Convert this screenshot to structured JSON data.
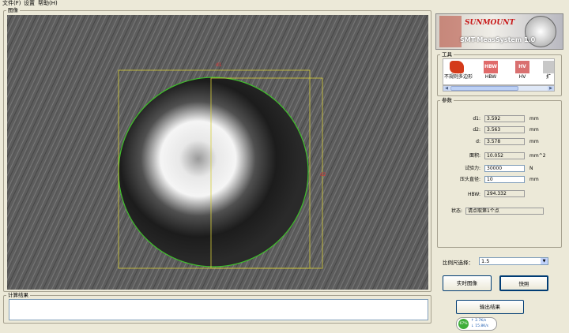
{
  "menu": [
    "文件(F)",
    "设置",
    "帮助(H)"
  ],
  "image_group": {
    "title": "图像"
  },
  "overlay": {
    "top_label": "d1",
    "right_label": "d2"
  },
  "result_group": {
    "title": "计算结果",
    "text": ""
  },
  "logo": {
    "brand": "SUNMOUNT",
    "product": "SMT-MeasSystem 1.0"
  },
  "tools_group": {
    "title": "工具",
    "items": [
      {
        "label": "不规则多边形",
        "icon": "polygon-icon",
        "color": "#d43a1a"
      },
      {
        "label": "HBW",
        "icon": "hbw-icon",
        "color": "#e06a6a"
      },
      {
        "label": "HV",
        "icon": "hv-icon",
        "color": "#d97070"
      },
      {
        "label": "扩",
        "icon": "more-tool-icon",
        "color": "#c8c8c8"
      }
    ]
  },
  "params": {
    "title": "参数",
    "d1": {
      "label": "d1:",
      "value": "3.592",
      "unit": "mm"
    },
    "d2": {
      "label": "d2:",
      "value": "3.563",
      "unit": "mm"
    },
    "d": {
      "label": "d:",
      "value": "3.578",
      "unit": "mm"
    },
    "area": {
      "label": "面积:",
      "value": "10.052",
      "unit": "mm^2"
    },
    "force": {
      "label": "试验力:",
      "value": "30000",
      "unit": "N"
    },
    "ball": {
      "label": "压头直径:",
      "value": "10",
      "unit": "mm"
    },
    "hbw": {
      "label": "HBW:",
      "value": "294.332"
    },
    "status": {
      "label": "状态:",
      "value": "请点取第1个点"
    }
  },
  "scale": {
    "label": "比例尺选择：",
    "value": "1.5"
  },
  "buttons": {
    "live": "实时图像",
    "snap": "快照",
    "export": "输出结果"
  },
  "network": {
    "percent": "67%",
    "up": "2.7K/s",
    "down": "15.8K/s"
  }
}
